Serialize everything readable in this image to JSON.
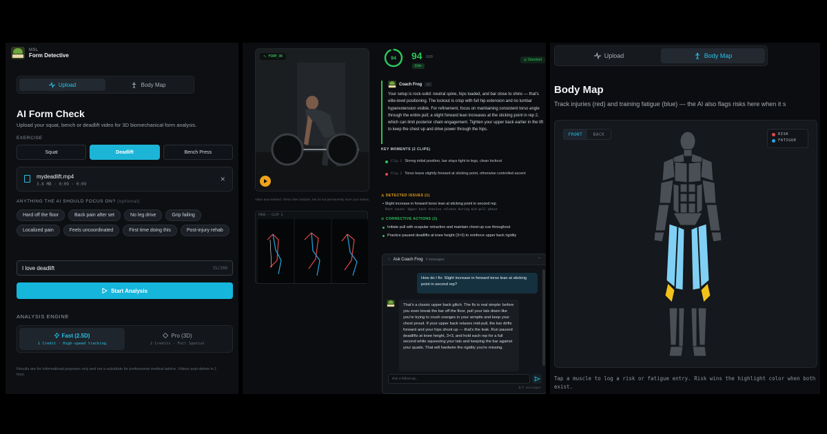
{
  "colors": {
    "accent": "#1cb5d8",
    "score_green": "#2ec45c",
    "risk": "#e5484d",
    "fatigue": "#27a6e8",
    "muscle_fatigue_fill": "#7fd0f4",
    "muscle_highlight": "#f2c21b"
  },
  "brand": {
    "sub": "MSL",
    "title": "Form Detective"
  },
  "nav": {
    "upload": "Upload",
    "body_map": "Body Map",
    "upload_icon": "activity-icon",
    "body_map_icon": "person-icon"
  },
  "upload_page": {
    "title": "AI Form Check",
    "subtitle": "Upload your squat, bench or deadlift video for 3D biomechanical form analysis.",
    "exercise_label": "EXERCISE",
    "exercises": [
      "Squat",
      "Deadlift",
      "Bench Press"
    ],
    "selected_exercise": "Deadlift",
    "file": {
      "name": "mydeadlift.mp4",
      "meta": "3.6 MB · 0:09 · 0:09"
    },
    "focus_label": "ANYTHING THE AI SHOULD FOCUS ON?",
    "focus_optional": "(optional)",
    "chips": [
      "Hard off the floor",
      "Back pain after set",
      "No leg drive",
      "Grip failing",
      "Localized pain",
      "Feels uncoordinated",
      "First time doing this",
      "Post-injury rehab"
    ],
    "input_value": "I love deadlift",
    "input_count": "15/200",
    "start_button": "Start Analysis",
    "engine_label": "ANALYSIS ENGINE",
    "engines": [
      {
        "name": "Fast (2.5D)",
        "desc": "1 Credit · High-speed tracking"
      },
      {
        "name": "Pro (3D)",
        "desc": "2 Credits · Full Spatial"
      }
    ],
    "disclaimer": "Results are for informational purposes only and not a substitute for professional medical advice. Videos auto-delete in 1 hour."
  },
  "results": {
    "video_tag": "FORM_OK",
    "video_note": "Video auto-deleted. These after analysis. We do not permanently store your videos.",
    "clips_label": "POSE — CLIP 3",
    "score": "94",
    "score_max": "/100",
    "score_badge": "Elite",
    "standard_badge": "Standard",
    "coach_name": "Coach Frog",
    "coach_tag": "AI",
    "coach_text": "Your setup is rock-solid: neutral spine, hips loaded, and bar close to shins — that's elite-level positioning. The lockout is crisp with full hip extension and no lumbar hyperextension visible. For refinement, focus on maintaining consistent torso angle through the entire pull; a slight forward lean increases at the sticking point in rep 2, which can limit posterior chain engagement. Tighten your upper back earlier in the lift to keep the chest up and drive power through the hips.",
    "moments_label": "KEY MOMENTS (2 CLIPS)",
    "moments": [
      {
        "clip": "Clip 1",
        "text": "Strong initial position, bar stays tight to legs, clean lockout"
      },
      {
        "clip": "Clip 2",
        "text": "Torso leans slightly forward at sticking point, otherwise controlled ascent"
      }
    ],
    "issues_label": "DETECTED ISSUES (1)",
    "issue": "Slight increase in forward torso lean at sticking point in second rep",
    "issue_cause": "Root cause: Upper back tension release during mid-pull phase",
    "actions_label": "CORRECTIVE ACTIONS (2)",
    "actions": [
      "Initiate pull with scapular retraction and maintain chest-up cue throughout",
      "Practice paused deadlifts at knee height (3×3) to reinforce upper back rigidity"
    ]
  },
  "chat": {
    "title": "Ask Coach Frog",
    "count": "2 messages",
    "user_msg": "How do I fix: Slight increase in forward torso lean at sticking point in second rep?",
    "ai_msg": "That's a classic upper back glitch. The fix is real simple: before you even break the bar off the floor, pull your lats down like you're trying to crush oranges in your armpits and keep your chest proud. If your upper back relaxes mid-pull, the bar drifts forward and your hips shoot up — that's the leak. Run paused deadlifts at knee height, 3×3, and hold each rep for a full second while squeezing your lats and keeping the bar against your quads. That will hardwire the rigidity you're missing.",
    "placeholder": "Ask a follow-up...",
    "footer": "0/2 messages"
  },
  "body_map": {
    "title": "Body Map",
    "subtitle": "Track injuries (red) and training fatigue (blue) — the AI also flags risks here when it s",
    "front": "FRONT",
    "back": "BACK",
    "legend_risk": "RISK",
    "legend_fatigue": "FATIGUE",
    "note": "Tap a muscle to log a risk or fatigue entry. Risk wins the highlight color when both exist."
  }
}
